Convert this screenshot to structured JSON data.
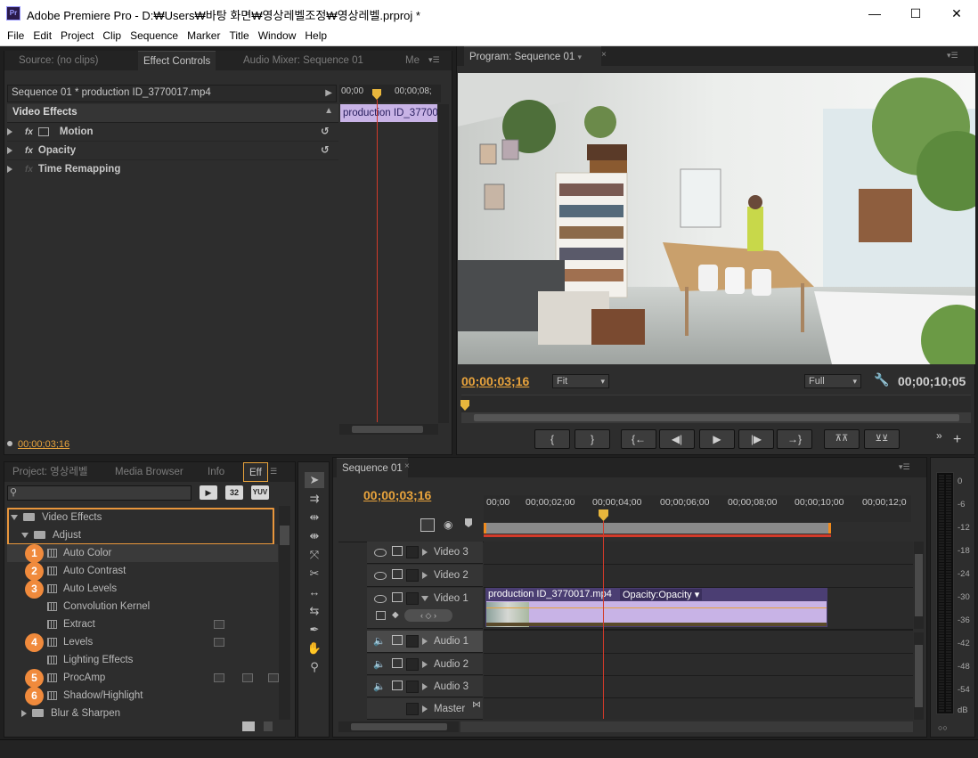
{
  "window": {
    "title": "Adobe Premiere Pro - D:₩Users₩바탕 화면₩영상레벨조정₩영상레벨.prproj *",
    "app_icon": "Pr",
    "controls": {
      "minimize": "—",
      "maximize": "☐",
      "close": "✕"
    }
  },
  "menu": [
    "File",
    "Edit",
    "Project",
    "Clip",
    "Sequence",
    "Marker",
    "Title",
    "Window",
    "Help"
  ],
  "source_panel": {
    "tabs": [
      "Source: (no clips)",
      "Effect Controls",
      "Audio Mixer: Sequence 01",
      "Me"
    ],
    "active_tab": "Effect Controls",
    "clip_header": "Sequence 01 * production ID_3770017.mp4",
    "ruler_start": "00;00",
    "ruler_end": "00;00;08;",
    "clip_bar_label": "production ID_37700",
    "section_header": "Video Effects",
    "effects": [
      {
        "name": "Motion",
        "resettable": true
      },
      {
        "name": "Opacity",
        "resettable": true
      },
      {
        "name": "Time Remapping",
        "resettable": false
      }
    ],
    "timecode": "00;00;03;16"
  },
  "program_monitor": {
    "tab": "Program: Sequence 01",
    "current_time": "00;00;03;16",
    "zoom": "Fit",
    "quality": "Full",
    "duration": "00;00;10;05",
    "transport_buttons": [
      "{",
      "}",
      "{←",
      "◀|",
      "▶",
      "|▶",
      "→}",
      "lift",
      "extract"
    ]
  },
  "project_panel": {
    "tabs": [
      "Project: 영상레벨",
      "Media Browser",
      "Info",
      "Eff"
    ],
    "search_placeholder": "",
    "filter_labels": [
      "32",
      "YUV"
    ],
    "tree": [
      {
        "label": "Video Effects",
        "level": 0,
        "type": "folder",
        "expanded": true,
        "highlight": true
      },
      {
        "label": "Adjust",
        "level": 1,
        "type": "folder",
        "expanded": true,
        "highlight": true
      },
      {
        "label": "Auto Color",
        "level": 2,
        "type": "effect",
        "badge": "1"
      },
      {
        "label": "Auto Contrast",
        "level": 2,
        "type": "effect",
        "badge": "2"
      },
      {
        "label": "Auto Levels",
        "level": 2,
        "type": "effect",
        "badge": "3"
      },
      {
        "label": "Convolution Kernel",
        "level": 2,
        "type": "effect",
        "badge": ""
      },
      {
        "label": "Extract",
        "level": 2,
        "type": "effect",
        "badge": ""
      },
      {
        "label": "Levels",
        "level": 2,
        "type": "effect",
        "badge": "4"
      },
      {
        "label": "Lighting Effects",
        "level": 2,
        "type": "effect",
        "badge": ""
      },
      {
        "label": "ProcAmp",
        "level": 2,
        "type": "effect",
        "badge": "5"
      },
      {
        "label": "Shadow/Highlight",
        "level": 2,
        "type": "effect",
        "badge": "6"
      },
      {
        "label": "Blur & Sharpen",
        "level": 1,
        "type": "folder",
        "expanded": false,
        "badge": ""
      }
    ]
  },
  "timeline": {
    "tab": "Sequence 01",
    "current_time": "00;00;03;16",
    "ruler_labels": [
      "00;00",
      "00;00;02;00",
      "00;00;04;00",
      "00;00;06;00",
      "00;00;08;00",
      "00;00;10;00",
      "00;00;12;0"
    ],
    "tracks": [
      {
        "name": "Video 3",
        "kind": "video"
      },
      {
        "name": "Video 2",
        "kind": "video"
      },
      {
        "name": "Video 1",
        "kind": "video",
        "expanded": true
      },
      {
        "name": "Audio 1",
        "kind": "audio",
        "selected": true
      },
      {
        "name": "Audio 2",
        "kind": "audio"
      },
      {
        "name": "Audio 3",
        "kind": "audio"
      },
      {
        "name": "Master",
        "kind": "master"
      }
    ],
    "clip": {
      "name": "production ID_3770017.mp4",
      "effect_label": "Opacity:Opacity"
    }
  },
  "audio_meter": {
    "labels": [
      "0",
      "-6",
      "-12",
      "-18",
      "-24",
      "-30",
      "-36",
      "-42",
      "-48",
      "-54",
      "dB"
    ]
  },
  "colors": {
    "accent_orange": "#e8a33c",
    "badge_orange": "#f08a3c",
    "playhead_red": "#d23a2a",
    "clip_purple": "#c8b3e6",
    "clip_header": "#4b3e73"
  }
}
